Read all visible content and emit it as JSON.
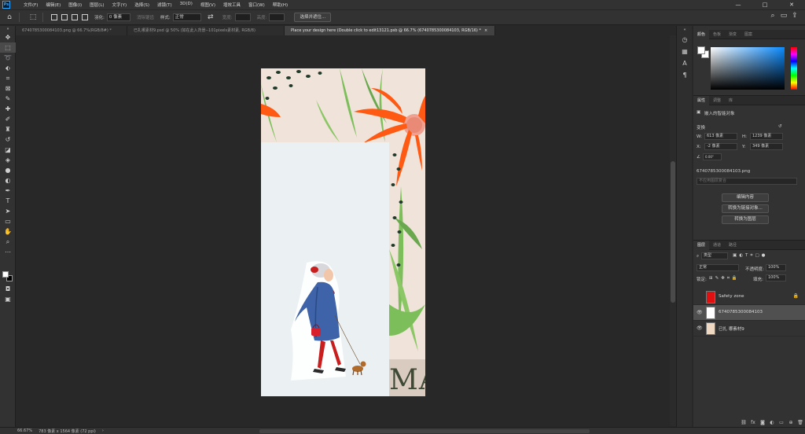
{
  "menu": [
    "文件(F)",
    "编辑(E)",
    "图像(I)",
    "图层(L)",
    "文字(Y)",
    "选择(S)",
    "滤镜(T)",
    "3D(D)",
    "视图(V)",
    "增效工具",
    "窗口(W)",
    "帮助(H)"
  ],
  "window_controls": {
    "minimize": "—",
    "maximize": "□",
    "close": "✕"
  },
  "options": {
    "feather_label": "羽化:",
    "feather_value": "0 像素",
    "antialias_label": "消除锯齿",
    "style_label": "样式:",
    "style_value": "正常",
    "width_label": "宽度:",
    "height_label": "高度:",
    "select_mask_button": "选择并遮住..."
  },
  "tabs": [
    {
      "label": "6740785300084103.png @ 66.7%(RGB/8#) *",
      "close": "×"
    },
    {
      "label": "已扎哪素材9.psd @ 50% (如在此入背景--101pixels素材素, RGB/8)",
      "close": "×"
    },
    {
      "label": "Place your design here (Double click to edit13121.psb @ 66.7% (6740785300084103, RGB/16) *",
      "close": "×"
    }
  ],
  "canvas": {
    "big_text": "MAI"
  },
  "status": {
    "zoom": "66.67%",
    "doc_info": "783 像素 x 1564 像素 (72 ppi)",
    "arrow": "›"
  },
  "color_panel": {
    "tabs": [
      "颜色",
      "色板",
      "渐变",
      "图案"
    ]
  },
  "properties_panel": {
    "tabs": [
      "属性",
      "调整",
      "库"
    ],
    "type_label": "嵌入的智能对象",
    "transform_label": "变换",
    "w_label": "W:",
    "w_value": "613 像素",
    "h_label": "H:",
    "h_value": "1239 像素",
    "x_label": "X:",
    "x_value": "-2 像素",
    "y_label": "Y:",
    "y_value": "349 像素",
    "angle_value": "0.00°",
    "filename": "6740785300084103.png",
    "comp_placeholder": "不应用图层复合",
    "btn_edit": "编辑内容",
    "btn_convert_linked": "转换为链接对象...",
    "btn_convert_layers": "转换为图层"
  },
  "layers_panel": {
    "tabs": [
      "图层",
      "通道",
      "路径"
    ],
    "kind_value": "类型",
    "blend_value": "正常",
    "opacity_label": "不透明度:",
    "opacity_value": "100%",
    "lock_label": "锁定:",
    "fill_label": "填充:",
    "fill_value": "100%",
    "layers": [
      {
        "name": "Safety zone",
        "locked": true,
        "visible": false,
        "color": "#e01010"
      },
      {
        "name": "6740785300084103",
        "locked": false,
        "visible": true,
        "color": "#ffffff"
      },
      {
        "name": "已扎 哪素材9",
        "locked": false,
        "visible": true,
        "color": "#f0d9c2"
      }
    ]
  },
  "colors": {
    "accent_orange": "#ff5a14",
    "leaf_green": "#7cbf5a",
    "dark_dots": "#1f3a2a",
    "placeholder": "#ebf0f3"
  }
}
